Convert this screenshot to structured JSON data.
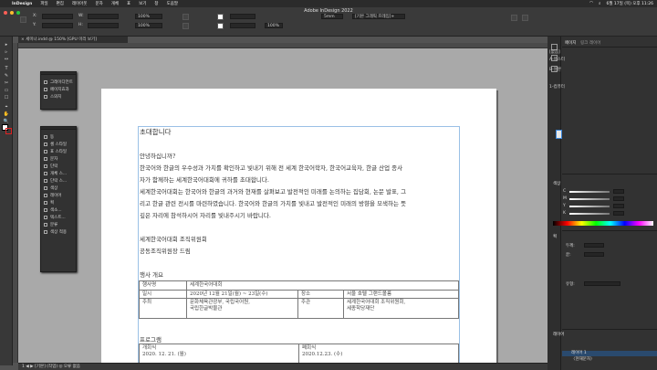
{
  "menubar": {
    "app": "InDesign",
    "items": [
      "파일",
      "편집",
      "레이아웃",
      "문자",
      "개체",
      "표",
      "보기",
      "창",
      "도움말"
    ],
    "clock": "6월 17일 (목) 오후 11:26"
  },
  "window": {
    "title": "Adobe InDesign 2022"
  },
  "control": {
    "x_label": "X:",
    "y_label": "Y:",
    "w_label": "W:",
    "h_label": "H:",
    "pct1": "100%",
    "pct2": "100%",
    "stroke_size": "5mm",
    "style_field": "[기본 그래픽 프레임]+"
  },
  "document": {
    "tab": "× 세미나.indd @ 150% [GPU 미리 보기]"
  },
  "tools": [
    "▸",
    "▹",
    "↔",
    "T",
    "✎",
    "✂",
    "▭",
    "☐",
    "⌖",
    "✋",
    "🔍"
  ],
  "float_panel_a": {
    "items": [
      "그레이디언트",
      "페이지효과",
      "스와치"
    ]
  },
  "float_panel_b": {
    "items": [
      "동",
      "셀 스타일",
      "표 스타일",
      "문자",
      "단락",
      "개체 스...",
      "단락 스...",
      "색상",
      "레이어",
      "획",
      "색소...",
      "텍스트...",
      "분류",
      "색상 적용"
    ]
  },
  "page_text": {
    "line1": "초대합니다",
    "line2": "안녕하십니까?",
    "line3": "한국어와 한글의 우수성과 가치를 확인하고 빛내기 위해 전 세계 한국어학자, 한국어교육자, 한글 산업 종사",
    "line4": "자가 함께하는 세계한국어대회에 귀하를 초대합니다.",
    "line5": "세계한국어대회는 한국어와 한글의 과거와 현재를 살펴보고 발전적인 미래를 논의하는 집담회, 논문 발표, 그",
    "line6": "리고 한글 관련 전시를 마련하였습니다. 한국어와 한글의 가치를 빛내고 발전적인 미래의 방향을 모색하는 뜻",
    "line7": "깊은 자리에 참석하시어 자리를 빛내주시기 바랍니다.",
    "line8": "세계한국어대회 조직위원회",
    "line9": "공동조직위원장 드림",
    "section1": "행사 개요",
    "section2": "프로그램"
  },
  "table1": {
    "r1": [
      "행사명",
      "세계한국어대회"
    ],
    "r2": [
      "일시",
      "2020년 12월 21일(월) ~ 23일(수)",
      "장소",
      "서울 호텔 그랜드볼룸"
    ],
    "r3": [
      "주최",
      "문화체육관광부, 국립국어원,\n국립한글박물관",
      "주관",
      "세계한국어대회 조직위원회,\n세종학당재단"
    ]
  },
  "table2": {
    "c1": "개회식\n2020. 12. 21. (월)",
    "c2": "폐회식\n2020.12.23. (수)"
  },
  "right_panel": {
    "tabs": [
      "페이지",
      "링크",
      "레이어"
    ],
    "pages_label": "[없음]",
    "master_a": "A-마스터",
    "master_b": "B-원본",
    "page_label": "1-컴퓨터",
    "color_head": "색상",
    "cmyk": [
      "C",
      "M",
      "Y",
      "K"
    ],
    "stroke_head": "획",
    "weight_label": "두께:",
    "cap_label": "끝:",
    "type_label": "유형:",
    "layers_head": "레이어",
    "layers": [
      "레이어 1",
      "〈현재문자〉"
    ]
  },
  "status": {
    "text": "1 ◀ ▶ [기본] (작업) ◎ 오류 없음"
  }
}
